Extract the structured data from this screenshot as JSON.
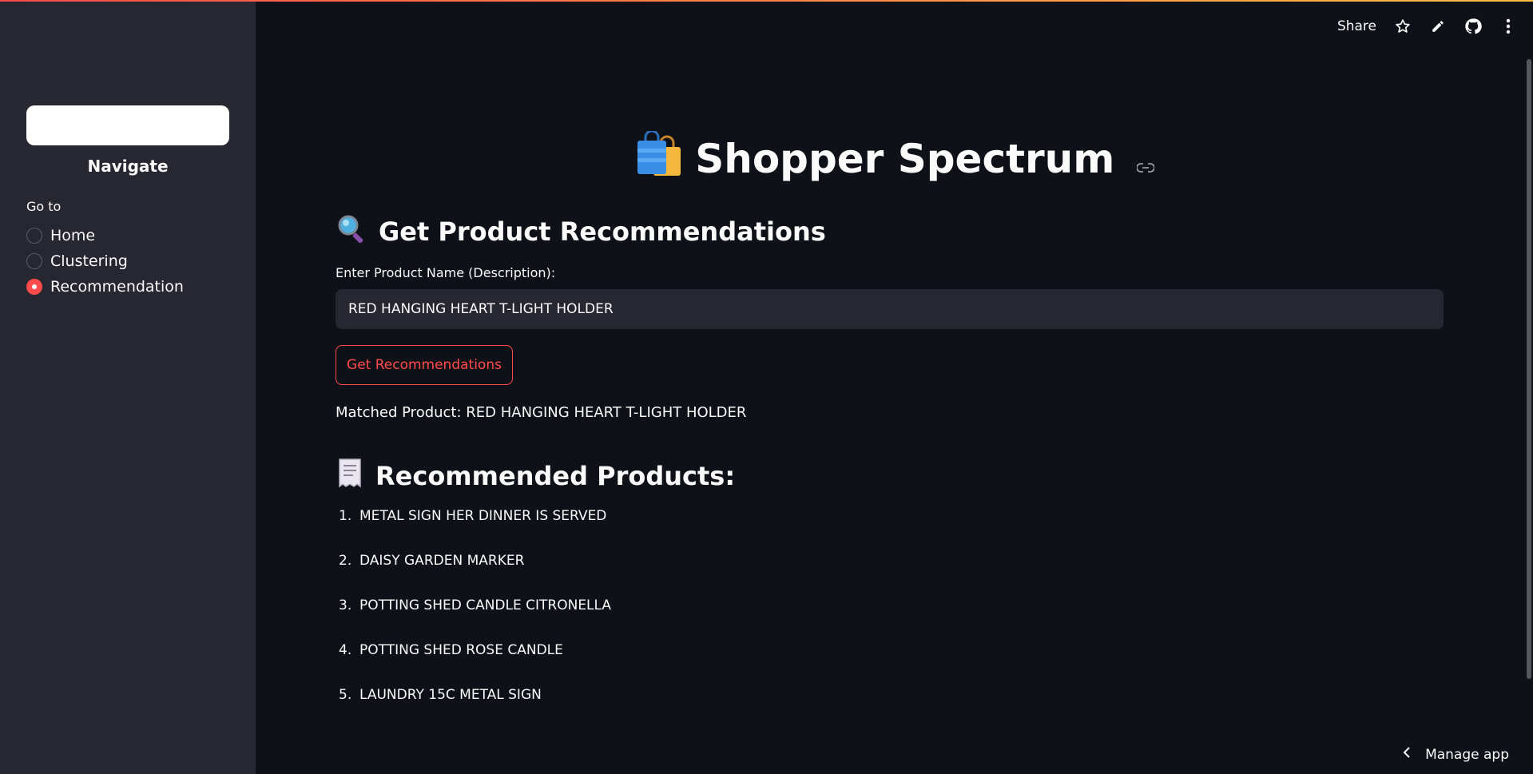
{
  "app": {
    "title": "Shopper Spectrum",
    "accent": "#ff4b4b"
  },
  "sidebar": {
    "heading": "Navigate",
    "radio_label": "Go to",
    "options": [
      {
        "label": "Home",
        "checked": false
      },
      {
        "label": "Clustering",
        "checked": false
      },
      {
        "label": "Recommendation",
        "checked": true
      }
    ]
  },
  "toolbar": {
    "share_label": "Share",
    "icons": [
      "star-icon",
      "pencil-icon",
      "github-icon",
      "kebab-menu-icon"
    ]
  },
  "main": {
    "section_heading": "Get Product Recommendations",
    "input_label": "Enter Product Name (Description):",
    "input_value": "RED HANGING HEART T-LIGHT HOLDER",
    "button_label": "Get Recommendations",
    "matched_text": "Matched Product: RED HANGING HEART T-LIGHT HOLDER",
    "results_heading": "Recommended Products:",
    "recommendations": [
      {
        "num": "1.",
        "name": "METAL SIGN HER DINNER IS SERVED"
      },
      {
        "num": "2.",
        "name": "DAISY GARDEN MARKER"
      },
      {
        "num": "3.",
        "name": "POTTING SHED CANDLE CITRONELLA"
      },
      {
        "num": "4.",
        "name": "POTTING SHED ROSE CANDLE"
      },
      {
        "num": "5.",
        "name": "LAUNDRY 15C METAL SIGN"
      }
    ]
  },
  "footer": {
    "manage_label": "Manage app"
  }
}
